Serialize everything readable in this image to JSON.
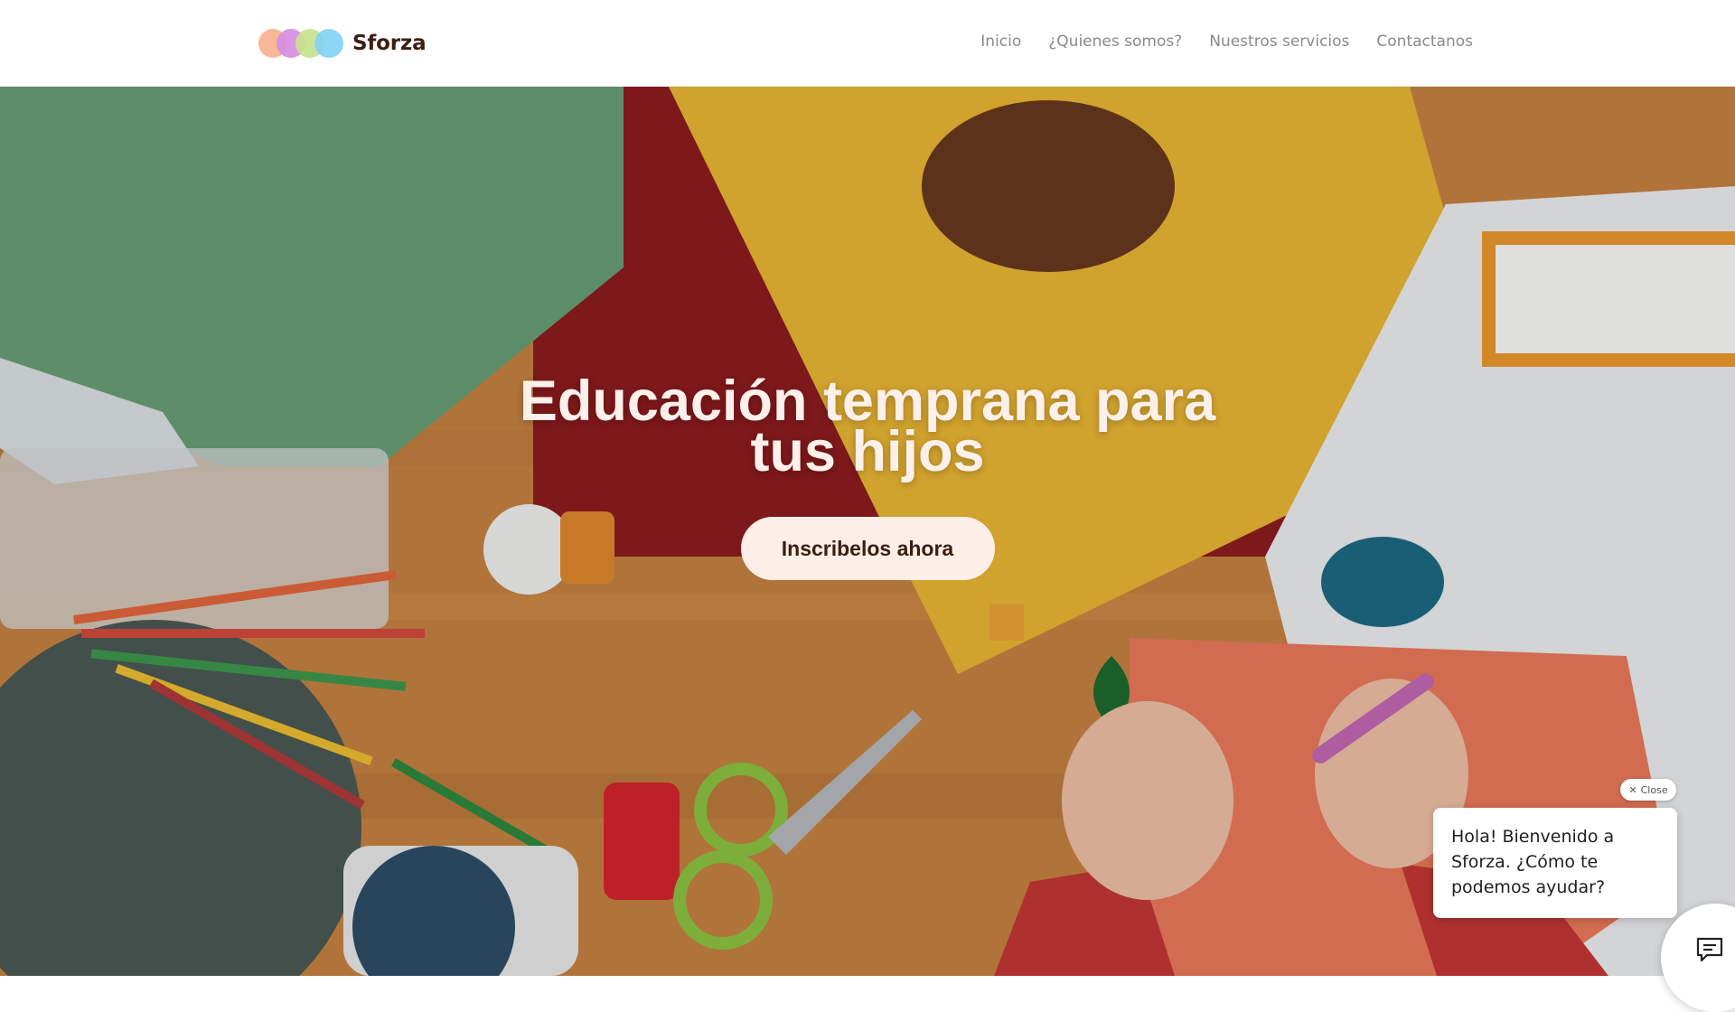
{
  "brand": {
    "name": "Sforza",
    "logo_colors": [
      "#f7b28d",
      "#d48ee0",
      "#c7e38c",
      "#83d3f4"
    ]
  },
  "nav": {
    "items": [
      {
        "label": "Inicio"
      },
      {
        "label": "¿Quienes somos?"
      },
      {
        "label": "Nuestros servicios"
      },
      {
        "label": "Contactanos"
      }
    ]
  },
  "hero": {
    "title": "Educación temprana para tus hijos",
    "cta_label": "Inscribelos ahora"
  },
  "chat": {
    "close_label": "Close",
    "message": "Hola! Bienvenido a Sforza. ¿Cómo te podemos ayudar?"
  },
  "colors": {
    "brand_text": "#3b1e12",
    "cta_bg": "#fdefe8",
    "nav_text": "#8a8a8a"
  }
}
